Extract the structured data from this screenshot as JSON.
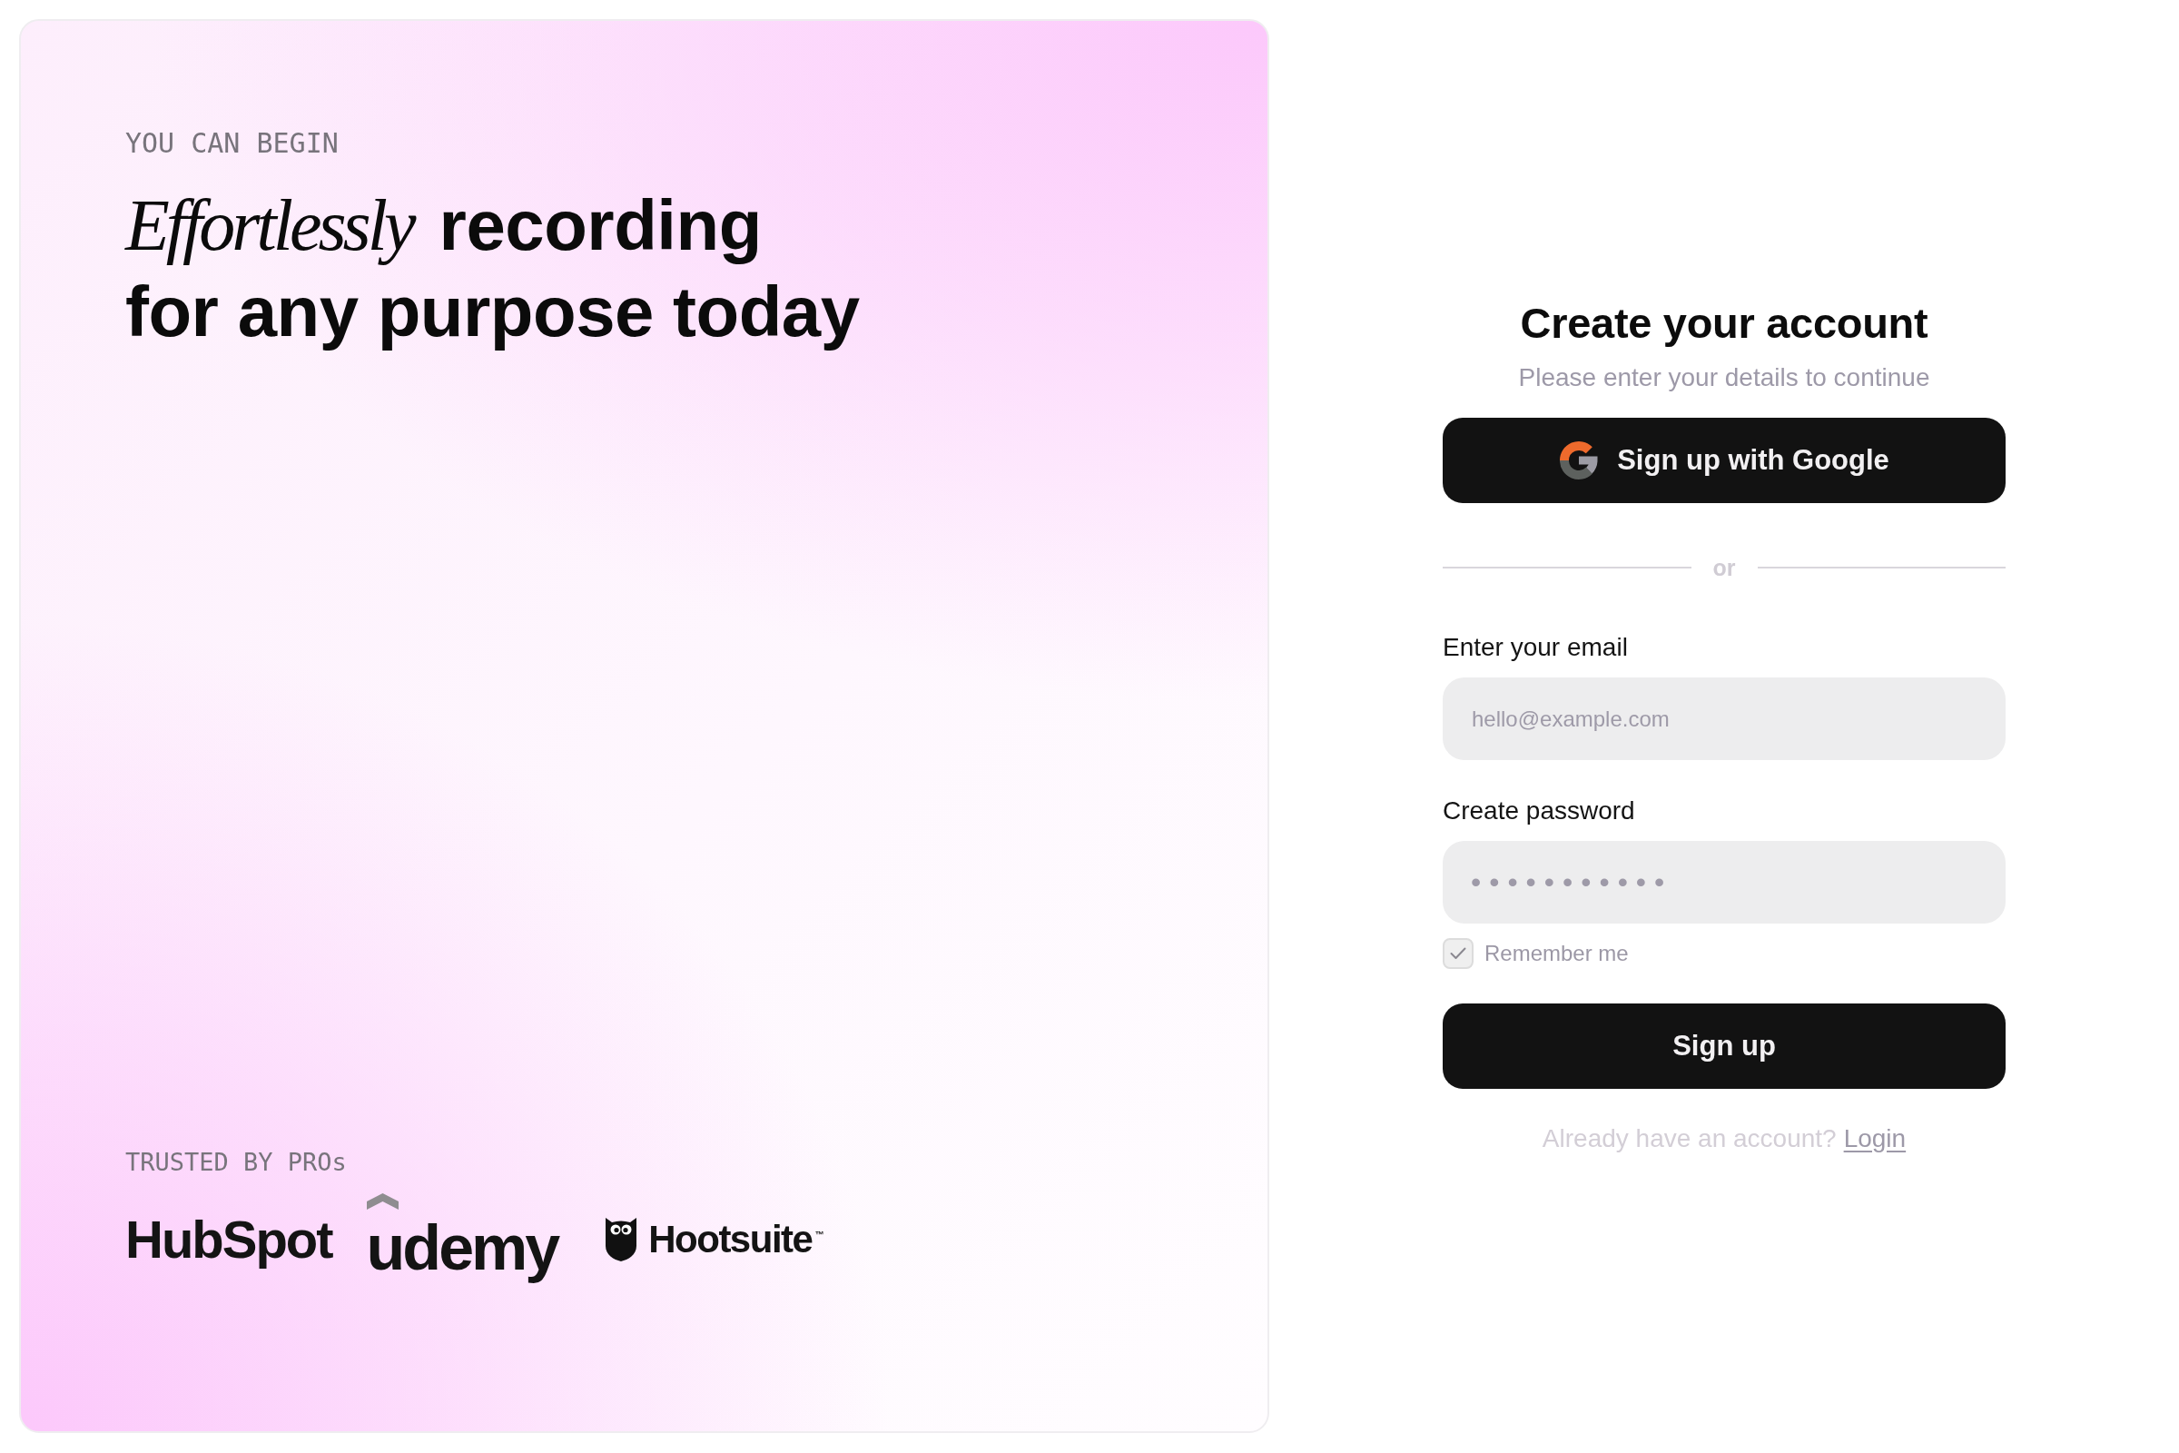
{
  "hero": {
    "eyebrow": "YOU CAN BEGIN",
    "headline_lines": [
      "*Effortlessly* recording",
      "for any purpose today"
    ],
    "trust_label": "TRUSTED BY PROs",
    "logos": [
      {
        "kind": "wordmark",
        "name": "HubSpot"
      },
      {
        "kind": "hat",
        "name": "udemy"
      },
      {
        "kind": "owl",
        "name": "Hootsuite$^{™}$"
      }
    ]
  },
  "signup": {
    "title": "Create your account",
    "subtitle": "Please enter your details to continue",
    "google_button": "Sign up with Google",
    "divider": "or",
    "fields": [
      {
        "kind": "email",
        "label": "Enter your email",
        "placeholder": "hello@example.com"
      },
      {
        "kind": "password",
        "label": "Create password",
        "placeholder": "•••••••••••"
      }
    ],
    "remember": {
      "label": "Remember me",
      "checked": true
    },
    "submit": "Sign up",
    "footer": {
      "prompt": "Already have an account?",
      "link": "Login"
    }
  }
}
